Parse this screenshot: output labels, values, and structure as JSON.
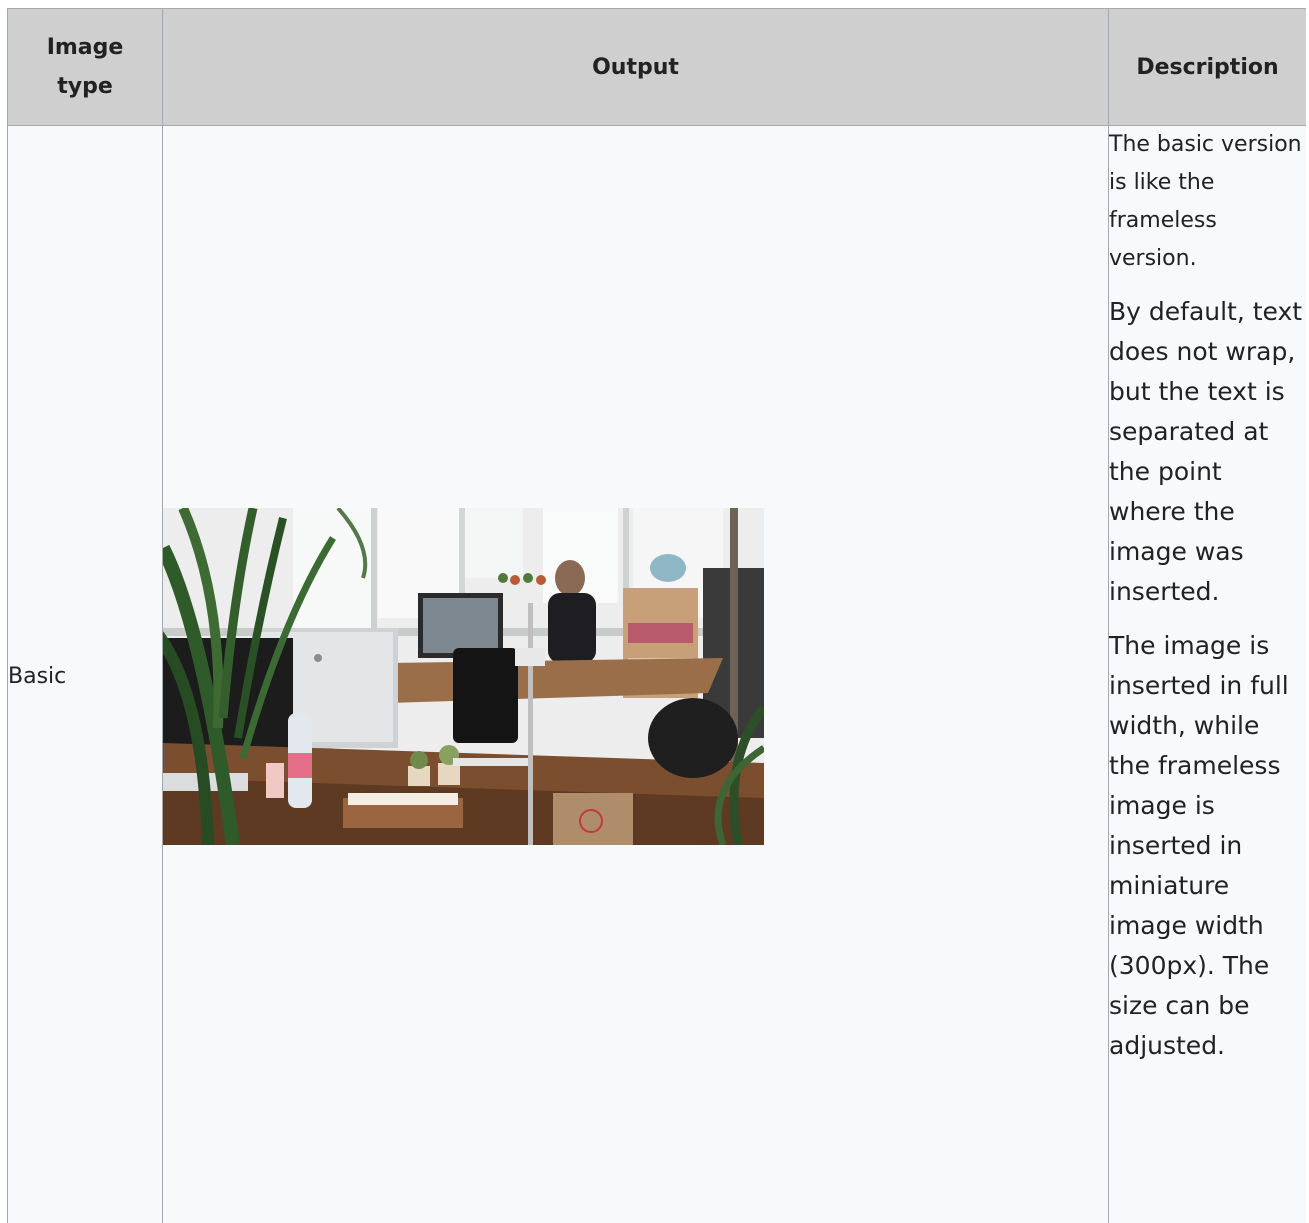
{
  "table": {
    "headers": [
      "Image type",
      "Output",
      "Description"
    ],
    "rows": [
      {
        "type": "Basic",
        "description": {
          "intro": "The basic version is like the frameless version.",
          "detail1": "By default, text does not wrap, but the text is separated at the point where the image was inserted.",
          "detail2": "The image is inserted in full width, while the frameless image is inserted in miniature image width (300px). The size can be adjusted."
        }
      }
    ]
  },
  "photo": {
    "subject": "office-desk-photo"
  }
}
